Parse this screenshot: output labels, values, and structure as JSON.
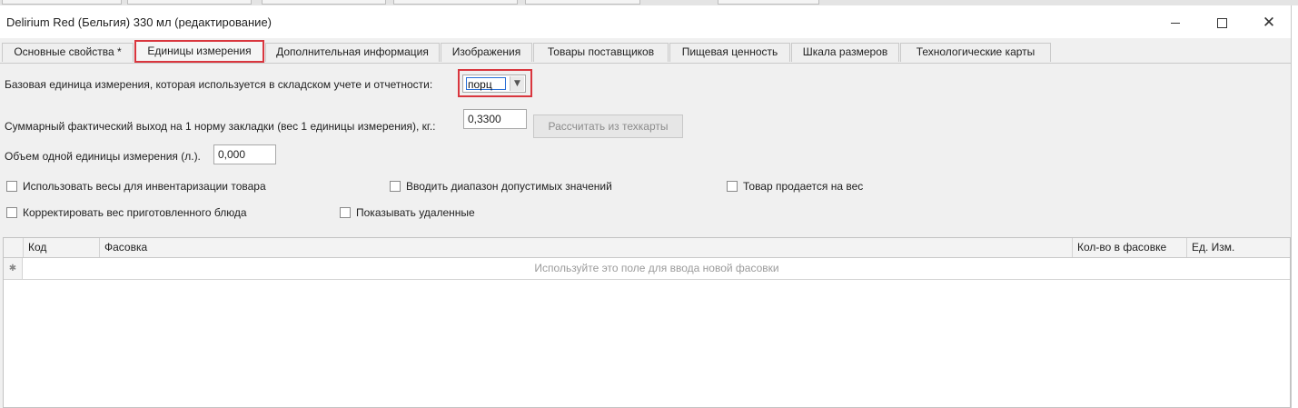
{
  "window": {
    "title": "Delirium Red (Бельгия) 330 мл (редактирование)"
  },
  "tabs": [
    {
      "label": "Основные свойства *"
    },
    {
      "label": "Единицы измерения"
    },
    {
      "label": "Дополнительная информация"
    },
    {
      "label": "Изображения"
    },
    {
      "label": "Товары поставщиков"
    },
    {
      "label": "Пищевая ценность"
    },
    {
      "label": "Шкала размеров"
    },
    {
      "label": "Технологические карты"
    }
  ],
  "active_tab": "Единицы измерения",
  "form": {
    "base_unit_label": "Базовая единица измерения, которая используется в складском учете и отчетности:",
    "base_unit_value": "порц",
    "total_yield_label": "Суммарный фактический выход на 1 норму закладки (вес 1 единицы измерения), кг.:",
    "total_yield_value": "0,3300",
    "calc_button": "Рассчитать из техкарты",
    "volume_label": "Объем одной единицы измерения (л.).",
    "volume_value": "0,000"
  },
  "checkboxes": {
    "use_scales": {
      "label": "Использовать весы для инвентаризации товара",
      "checked": false
    },
    "input_range": {
      "label": "Вводить диапазон допустимых значений",
      "checked": false
    },
    "sold_by_weight": {
      "label": "Товар продается на вес",
      "checked": false
    },
    "correct_weight": {
      "label": "Корректировать вес приготовленного блюда",
      "checked": false
    },
    "show_deleted": {
      "label": "Показывать удаленные",
      "checked": false
    }
  },
  "grid": {
    "columns": [
      "Код",
      "Фасовка",
      "Кол-во в фасовке",
      "Ед. Изм."
    ],
    "new_row_marker": "✱",
    "new_row_hint": "Используйте это поле для ввода новой фасовки"
  },
  "colors": {
    "highlight": "#d9363e",
    "window_bg": "#f0f0f0"
  }
}
